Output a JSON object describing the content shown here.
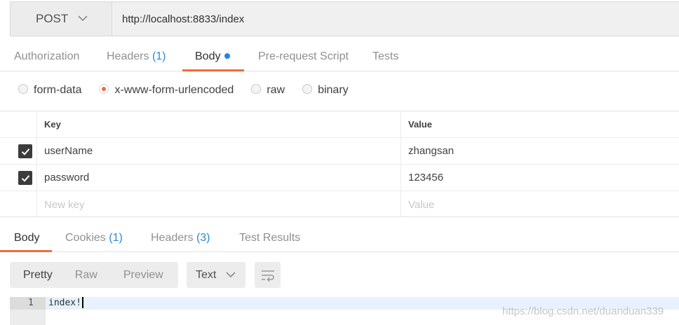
{
  "request": {
    "method": "POST",
    "url": "http://localhost:8833/index"
  },
  "request_tabs": [
    {
      "label": "Authorization",
      "count": ""
    },
    {
      "label": "Headers",
      "count": "(1)"
    },
    {
      "label": "Body",
      "count": ""
    },
    {
      "label": "Pre-request Script",
      "count": ""
    },
    {
      "label": "Tests",
      "count": ""
    }
  ],
  "active_request_tab": "Body",
  "body_types": [
    {
      "label": "form-data",
      "selected": false
    },
    {
      "label": "x-www-form-urlencoded",
      "selected": true
    },
    {
      "label": "raw",
      "selected": false
    },
    {
      "label": "binary",
      "selected": false
    }
  ],
  "params": {
    "key_header": "Key",
    "value_header": "Value",
    "rows": [
      {
        "key": "userName",
        "value": "zhangsan",
        "checked": true
      },
      {
        "key": "password",
        "value": "123456",
        "checked": true
      }
    ],
    "new_key_placeholder": "New key",
    "new_value_placeholder": "Value"
  },
  "response_tabs": [
    {
      "label": "Body",
      "count": ""
    },
    {
      "label": "Cookies",
      "count": "(1)"
    },
    {
      "label": "Headers",
      "count": "(3)"
    },
    {
      "label": "Test Results",
      "count": ""
    }
  ],
  "active_response_tab": "Body",
  "view_modes": [
    "Pretty",
    "Raw",
    "Preview"
  ],
  "active_view_mode": "Pretty",
  "format": "Text",
  "response_lines": [
    {
      "number": "1",
      "text": "index!"
    }
  ],
  "watermark": "https://blog.csdn.net/duanduan339",
  "colors": {
    "accent": "#f26b3a",
    "count_blue": "#2a8ad4",
    "dot_blue": "#1f86e0"
  }
}
